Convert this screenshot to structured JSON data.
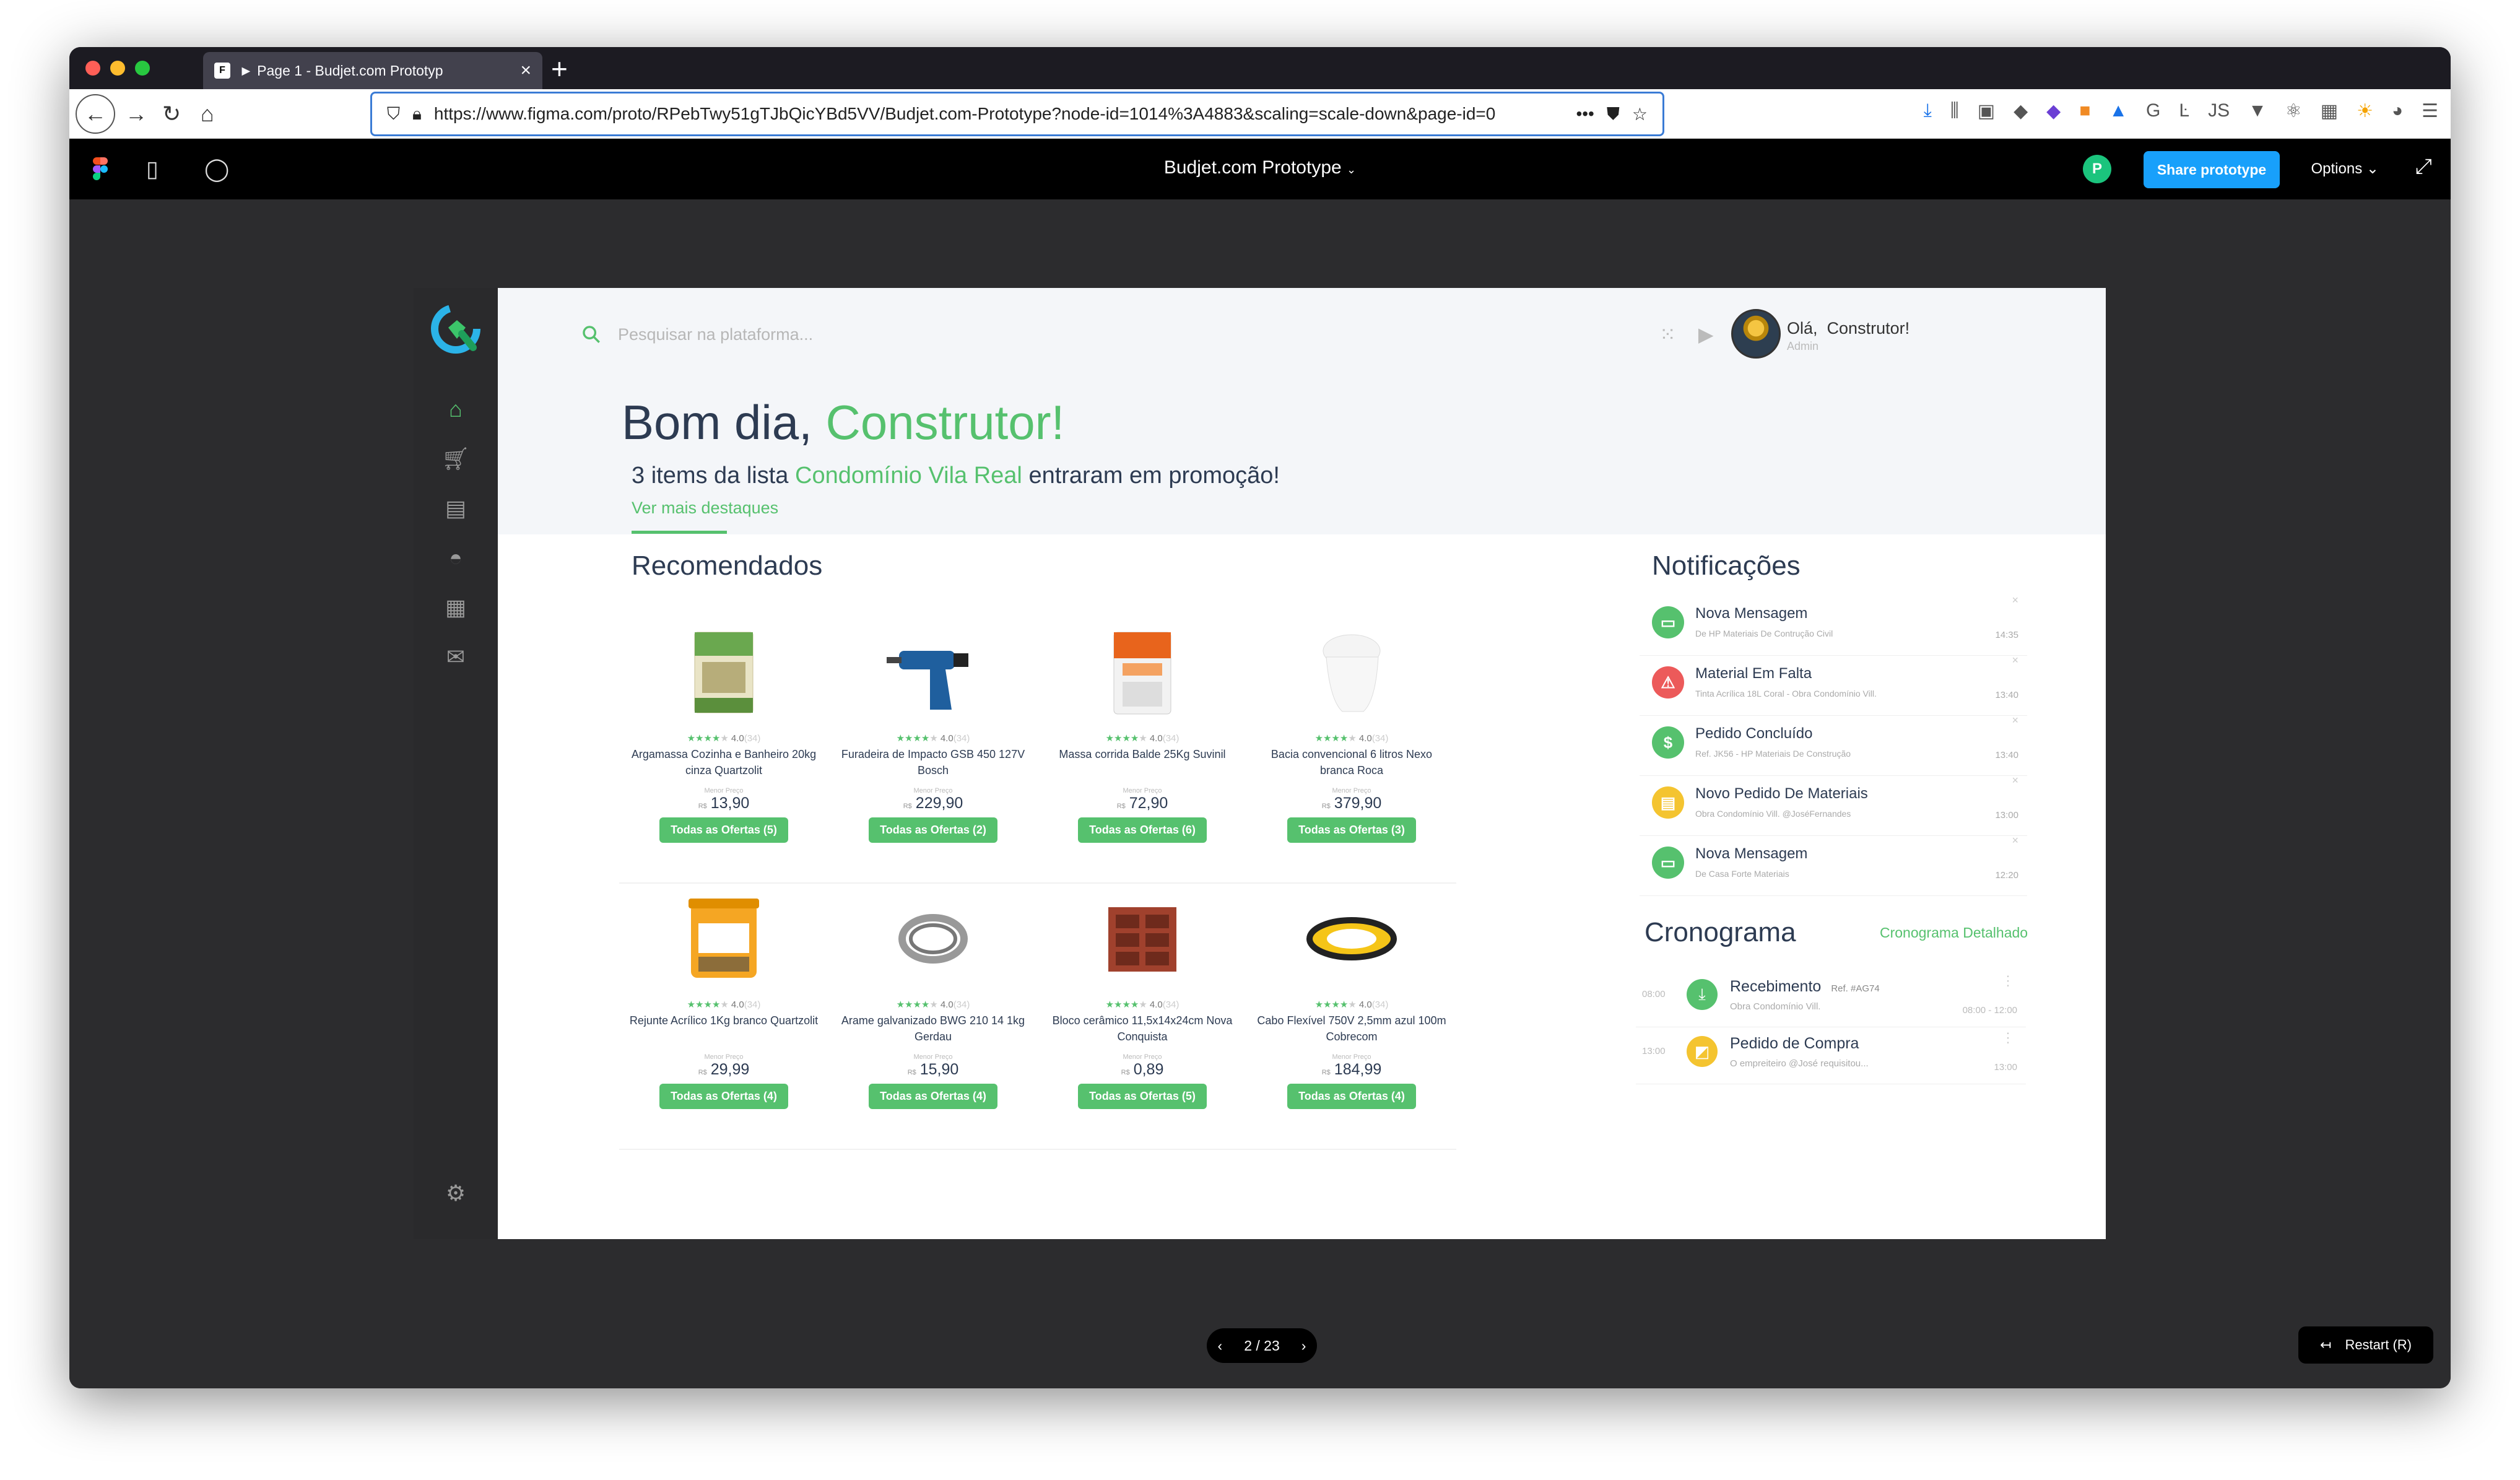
{
  "browser": {
    "tab_title": "► Page 1 - Budjet.com Prototyp",
    "url": "https://www.figma.com/proto/RPebTwy51gTJbQicYBd5VV/Budjet.com-Prototype?node-id=1014%3A4883&scaling=scale-down&page-id=0",
    "url_more": "•••"
  },
  "figma": {
    "title": "Budjet.com Prototype",
    "user_initial": "P",
    "share_label": "Share prototype",
    "options_label": "Options"
  },
  "app": {
    "search_placeholder": "Pesquisar na plataforma...",
    "user_greeting": "Olá,",
    "user_name": "Construtor!",
    "user_role": "Admin",
    "greeting_prefix": "Bom dia,",
    "greeting_name": "Construtor!",
    "promo_prefix": "3 items da lista",
    "promo_list": "Condomínio Vila Real",
    "promo_suffix": "entraram em promoção!",
    "more_highlights": "Ver mais destaques",
    "recommended_title": "Recomendados",
    "notifications_title": "Notificações",
    "schedule_title": "Cronograma",
    "schedule_link": "Cronograma Detalhado",
    "price_label": "Menor Preço",
    "currency": "R$"
  },
  "products": [
    {
      "name": "Argamassa Cozinha e Banheiro 20kg cinza Quartzolit",
      "rating": "4.0",
      "reviews": "(34)",
      "price": "13,90",
      "offers": "Todas as Ofertas (5)"
    },
    {
      "name": "Furadeira de Impacto GSB 450 127V Bosch",
      "rating": "4.0",
      "reviews": "(34)",
      "price": "229,90",
      "offers": "Todas as Ofertas (2)"
    },
    {
      "name": "Massa corrida Balde 25Kg Suvinil",
      "rating": "4.0",
      "reviews": "(34)",
      "price": "72,90",
      "offers": "Todas as Ofertas (6)"
    },
    {
      "name": "Bacia convencional 6 litros Nexo branca Roca",
      "rating": "4.0",
      "reviews": "(34)",
      "price": "379,90",
      "offers": "Todas as Ofertas (3)"
    },
    {
      "name": "Rejunte Acrílico 1Kg branco Quartzolit",
      "rating": "4.0",
      "reviews": "(34)",
      "price": "29,99",
      "offers": "Todas as Ofertas (4)"
    },
    {
      "name": "Arame galvanizado BWG 210 14 1kg Gerdau",
      "rating": "4.0",
      "reviews": "(34)",
      "price": "15,90",
      "offers": "Todas as Ofertas (4)"
    },
    {
      "name": "Bloco cerâmico 11,5x14x24cm Nova Conquista",
      "rating": "4.0",
      "reviews": "(34)",
      "price": "0,89",
      "offers": "Todas as Ofertas (5)"
    },
    {
      "name": "Cabo Flexível 750V 2,5mm azul 100m Cobrecom",
      "rating": "4.0",
      "reviews": "(34)",
      "price": "184,99",
      "offers": "Todas as Ofertas (4)"
    }
  ],
  "notifications": [
    {
      "title": "Nova Mensagem",
      "sub": "De HP Materiais De Contrução Civil",
      "time": "14:35",
      "color": "#56c16e",
      "icon": "chat-icon"
    },
    {
      "title": "Material Em Falta",
      "sub": "Tinta Acrílica 18L Coral - Obra Condomínio Vill.",
      "time": "13:40",
      "color": "#ec5a5a",
      "icon": "warning-icon"
    },
    {
      "title": "Pedido Concluído",
      "sub": "Ref. JK56 - HP Materiais De Construção",
      "time": "13:40",
      "color": "#56c16e",
      "icon": "dollar-icon"
    },
    {
      "title": "Novo Pedido De Materiais",
      "sub": "Obra Condomínio Vill. @JoséFernandes",
      "time": "13:00",
      "color": "#f4c430",
      "icon": "list-icon"
    },
    {
      "title": "Nova Mensagem",
      "sub": "De Casa Forte Materiais",
      "time": "12:20",
      "color": "#56c16e",
      "icon": "chat-icon"
    }
  ],
  "schedule": [
    {
      "hour": "08:00",
      "title": "Recebimento",
      "ref": "Ref. #AG74",
      "sub": "Obra Condomínio Vill.",
      "time": "08:00 - 12:00",
      "color": "#56c16e"
    },
    {
      "hour": "13:00",
      "title": "Pedido de Compra",
      "ref": "",
      "sub": "O empreiteiro @José requisitou...",
      "time": "13:00",
      "color": "#f4c430"
    }
  ],
  "pager": {
    "label": "2 / 23"
  },
  "restart_label": "Restart (R)"
}
